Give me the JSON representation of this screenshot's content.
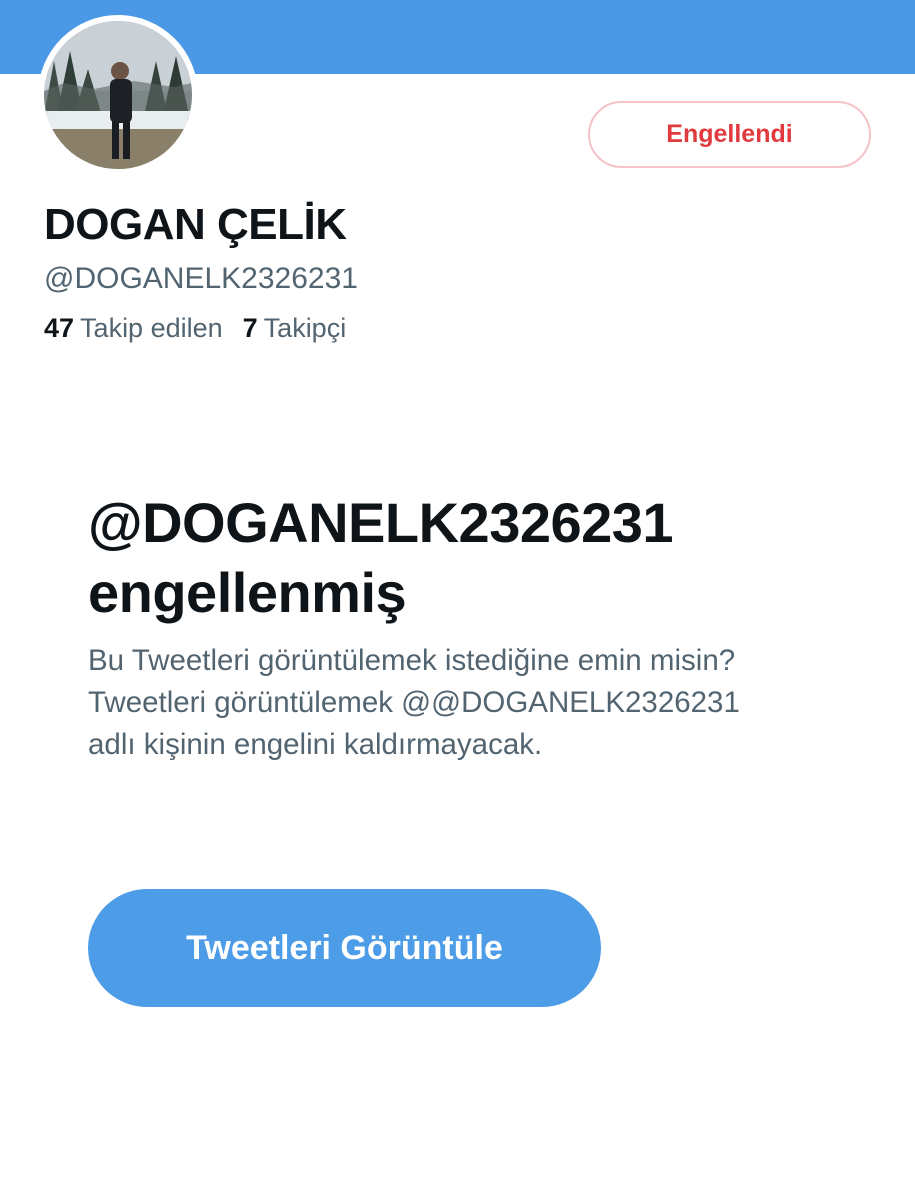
{
  "colors": {
    "banner": "#4a98e6",
    "accent": "#4c9ce8",
    "blocked_text": "#e0393e",
    "blocked_border": "#f5c2c7",
    "primary_text": "#0f1419",
    "secondary_text": "#536471"
  },
  "profile": {
    "display_name": "DOGAN ÇELİK",
    "handle": "@DOGANELK2326231",
    "avatar": "profile-photo",
    "block_button_label": "Engellendi",
    "following_count": "47",
    "following_label": "Takip edilen",
    "followers_count": "7",
    "followers_label": "Takipçi"
  },
  "block_notice": {
    "title_handle": "@DOGANELK2326231",
    "title_suffix": "engellenmiş",
    "body": "Bu Tweetleri görüntülemek istediğine emin misin? Tweetleri görüntülemek @@DOGANELK2326231 adlı kişinin engelini kaldırmayacak.",
    "view_button_label": "Tweetleri Görüntüle"
  }
}
